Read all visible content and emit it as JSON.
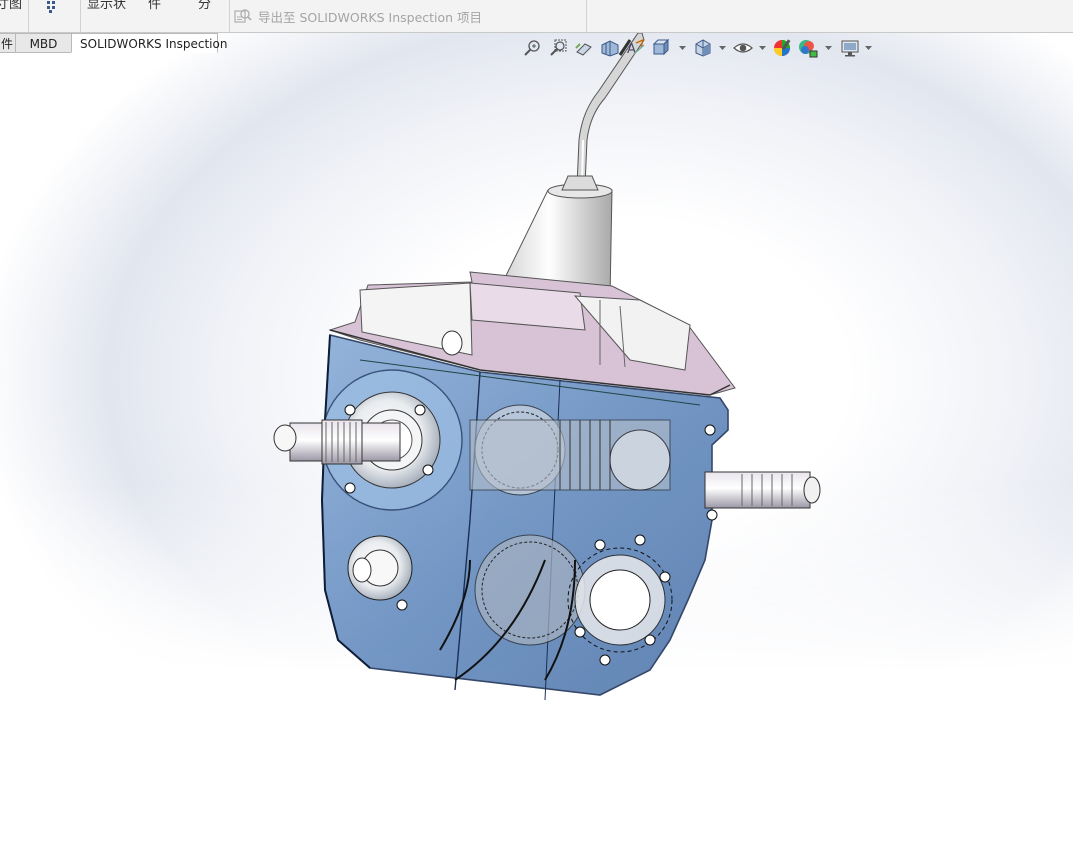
{
  "ribbon": {
    "fragments": [
      "寸图",
      "图",
      "显示状",
      "件",
      "分"
    ],
    "export_label": "导出至 SOLIDWORKS Inspection 项目"
  },
  "tabs": [
    {
      "label": "件",
      "active": false
    },
    {
      "label": "MBD",
      "active": false
    },
    {
      "label": "SOLIDWORKS Inspection",
      "active": true
    }
  ],
  "heads_up_toolbar": [
    {
      "name": "zoom-to-fit-icon"
    },
    {
      "name": "zoom-to-area-icon"
    },
    {
      "name": "previous-view-icon"
    },
    {
      "name": "section-view-icon"
    },
    {
      "name": "dynamic-annotation-views-icon"
    },
    {
      "name": "view-orientation-icon",
      "dropdown": true
    },
    {
      "name": "display-style-icon",
      "dropdown": true
    },
    {
      "name": "hide-show-items-icon",
      "dropdown": true
    },
    {
      "name": "edit-appearance-icon"
    },
    {
      "name": "apply-scene-icon",
      "dropdown": true
    },
    {
      "name": "view-settings-icon",
      "dropdown": true
    }
  ],
  "colors": {
    "housing_blue": "#6d95c6",
    "housing_dark": "#1a2f55",
    "cover_lilac": "#d9c2d6",
    "metal_white": "#f2f2f2"
  }
}
